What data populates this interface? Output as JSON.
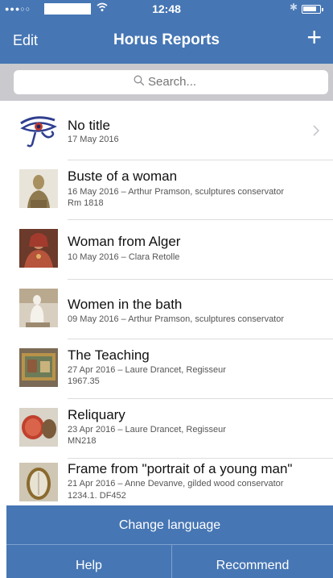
{
  "status_bar": {
    "signal": "●●●○○",
    "time": "12:48"
  },
  "nav": {
    "edit_label": "Edit",
    "title": "Horus Reports",
    "add_label": "+"
  },
  "search": {
    "placeholder": "Search..."
  },
  "reports": [
    {
      "title": "No title",
      "subtitle": "17 May 2016",
      "extra": "",
      "thumbnail": "eye-of-horus-icon"
    },
    {
      "title": "Buste of a woman",
      "subtitle": "16 May 2016 – Arthur Pramson, sculptures conservator",
      "extra": "Rm 1818",
      "thumbnail": "bust-photo"
    },
    {
      "title": "Woman from Alger",
      "subtitle": "10 May 2016 – Clara Retolle",
      "extra": "",
      "thumbnail": "painting-photo"
    },
    {
      "title": "Women in the bath",
      "subtitle": "09 May 2016 – Arthur Pramson, sculptures conservator",
      "extra": "",
      "thumbnail": "statue-photo"
    },
    {
      "title": "The Teaching",
      "subtitle": "27 Apr 2016 – Laure Drancet, Regisseur",
      "extra": "1967.35",
      "thumbnail": "framed-painting-photo"
    },
    {
      "title": "Reliquary",
      "subtitle": "23 Apr 2016 – Laure Drancet, Regisseur",
      "extra": "MN218",
      "thumbnail": "reliquary-photo"
    },
    {
      "title": "Frame from \"portrait of a young man\"",
      "subtitle": "21 Apr 2016 – Anne Devanve, gilded wood conservator",
      "extra": "1234.1. DF452",
      "thumbnail": "oval-frame-photo"
    }
  ],
  "footer": {
    "change_language": "Change language",
    "help": "Help",
    "recommend": "Recommend"
  },
  "colors": {
    "accent": "#4676b4",
    "search_bar_bg": "#c9c9ce"
  }
}
